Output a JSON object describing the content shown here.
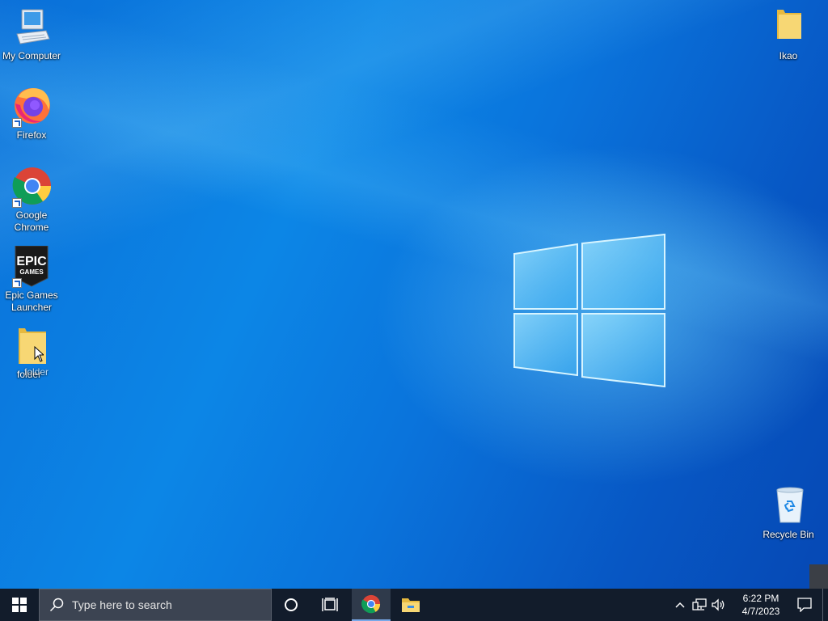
{
  "desktop": {
    "icons": [
      {
        "id": "my-computer",
        "label": "My Computer"
      },
      {
        "id": "firefox",
        "label": "Firefox"
      },
      {
        "id": "google-chrome",
        "label": "Google Chrome"
      },
      {
        "id": "epic-games-launcher",
        "label": "Epic Games Launcher",
        "logo_text_top": "EPIC",
        "logo_text_bottom": "GAMES"
      },
      {
        "id": "folder",
        "label": "folder",
        "label_overlap": "folder"
      },
      {
        "id": "ikao",
        "label": "Ikao"
      },
      {
        "id": "recycle-bin",
        "label": "Recycle Bin"
      }
    ]
  },
  "taskbar": {
    "search_placeholder": "Type here to search",
    "pinned": [
      {
        "name": "chrome",
        "active": true
      },
      {
        "name": "file-explorer",
        "active": false
      }
    ],
    "clock": {
      "time": "6:22 PM",
      "date": "4/7/2023"
    }
  },
  "colors": {
    "desktop_blue": "#0a74dc",
    "taskbar": "#121c2b",
    "search_box": "#3c4452"
  }
}
